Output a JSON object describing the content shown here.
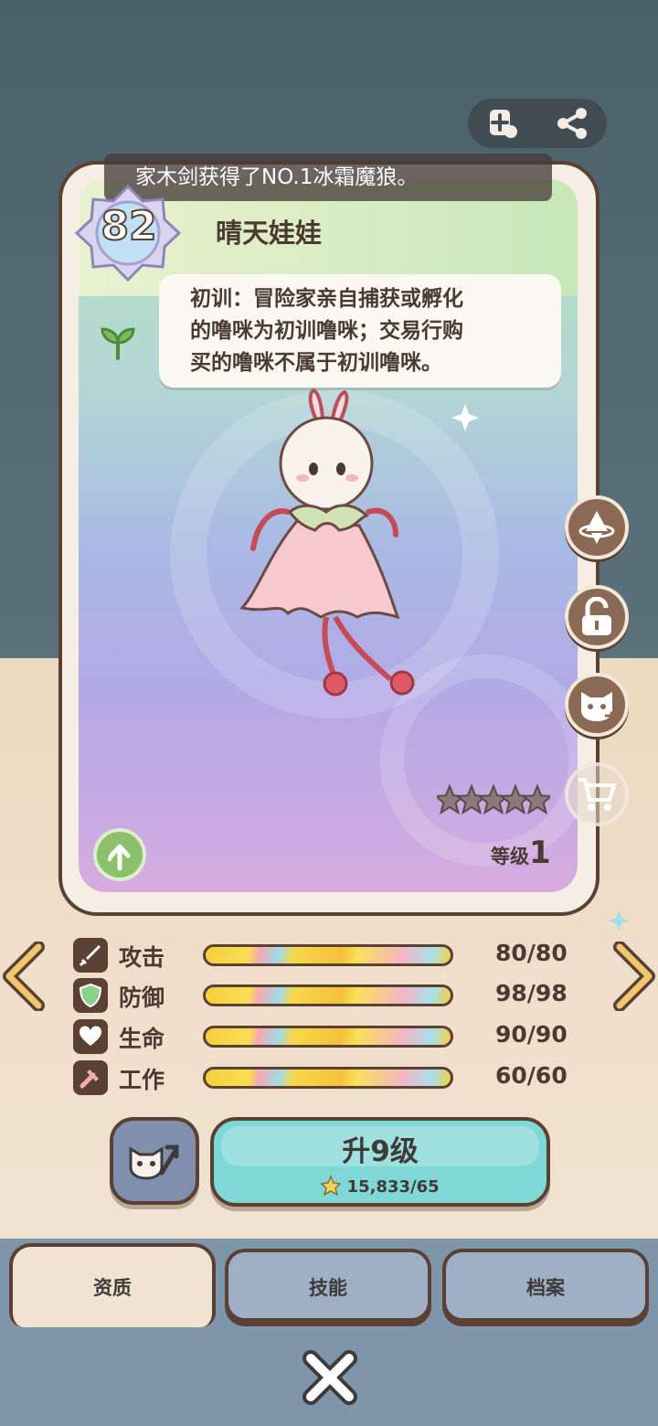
{
  "toolbar": {
    "add_icon": "add-card-icon",
    "share_icon": "share-icon"
  },
  "notice": {
    "text": "家木剑获得了NO.1冰霜魔狼。"
  },
  "pet": {
    "level_badge": "82",
    "name": "晴天娃娃",
    "tip": [
      "初训：冒险家亲自捕获或孵化",
      "的噜咪为初训噜咪；交易行购",
      "买的噜咪不属于初训噜咪。"
    ],
    "grade_label": "等级",
    "grade_value": "1",
    "stars_filled": 0,
    "stars_total": 5
  },
  "side_buttons": [
    "spin-top-icon",
    "unlock-icon",
    "pet-transfer-icon",
    "shop-cart-icon"
  ],
  "stats": [
    {
      "label": "攻击",
      "value": "80/80",
      "icon": "sword-icon"
    },
    {
      "label": "防御",
      "value": "98/98",
      "icon": "shield-icon"
    },
    {
      "label": "生命",
      "value": "90/90",
      "icon": "heart-icon"
    },
    {
      "label": "工作",
      "value": "60/60",
      "icon": "hammer-icon"
    }
  ],
  "actions": {
    "level_up_label": "升9级",
    "level_up_cost": "15,833/65"
  },
  "tabs": [
    {
      "label": "资质",
      "active": true
    },
    {
      "label": "技能",
      "active": false
    },
    {
      "label": "档案",
      "active": false
    }
  ],
  "colors": {
    "accent": "#7fd7d6",
    "outline": "#5b4134",
    "tab_inactive": "#9fb0c6"
  }
}
